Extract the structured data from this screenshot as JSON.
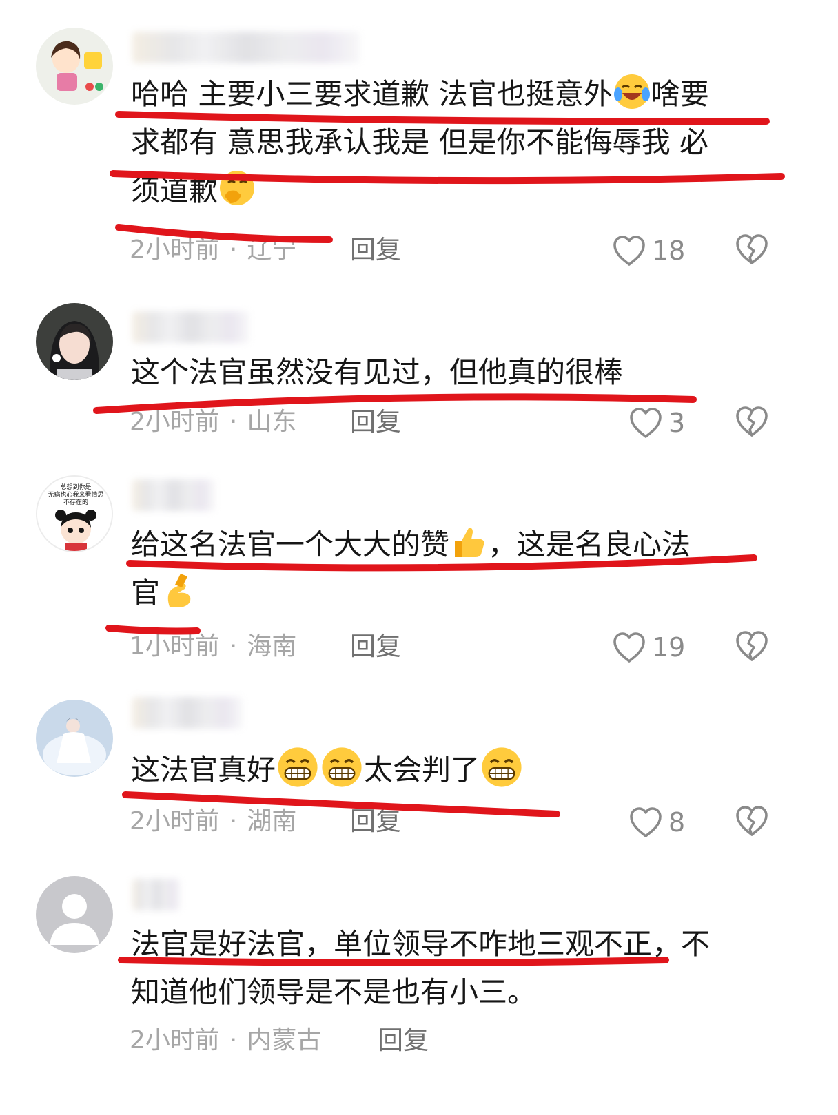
{
  "accent_colors": {
    "underline": "#e0151b",
    "meta": "#a6a6a6",
    "reply": "#707070"
  },
  "comments": [
    {
      "text_lines": [
        "哈哈 主要小三要求道歉 法官也挺意外",
        "啥要",
        "求都有 意思我承认我是 但是你不能侮辱我 必",
        "须道歉"
      ],
      "time": "2小时前",
      "location": "辽宁",
      "reply": "回复",
      "likes": "18"
    },
    {
      "text_lines": [
        "这个法官虽然没有见过，但他真的很棒"
      ],
      "time": "2小时前",
      "location": "山东",
      "reply": "回复",
      "likes": "3"
    },
    {
      "text_lines": [
        "给这名法官一个大大的赞",
        "，这是名良心法",
        "官"
      ],
      "avatar_caption": "总想到你是\n无病也心我来看情思\n不存在的",
      "time": "1小时前",
      "location": "海南",
      "reply": "回复",
      "likes": "19"
    },
    {
      "text_lines": [
        "这法官真好",
        "太会判了"
      ],
      "time": "2小时前",
      "location": "湖南",
      "reply": "回复",
      "likes": "8"
    },
    {
      "text_lines": [
        "法官是好法官，单位领导不咋地三观不正，不",
        "知道他们领导是不是也有小三。"
      ],
      "time": "2小时前",
      "location": "内蒙古",
      "reply": "回复"
    }
  ],
  "meta_separator": "·",
  "icons": {
    "like": "heart-outline-icon",
    "dislike": "broken-heart-icon",
    "avatar_default": "default-avatar-icon"
  }
}
